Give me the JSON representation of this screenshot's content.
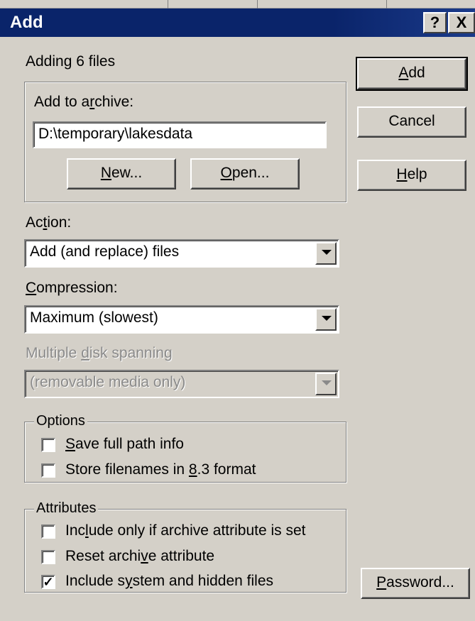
{
  "window": {
    "title": "Add",
    "help_button": "?",
    "close_button": "X"
  },
  "status": "Adding 6 files",
  "archive_group": {
    "label_pre": "Add to a",
    "label_ul": "r",
    "label_post": "chive:",
    "path_value": "D:\\temporary\\lakesdata",
    "new_pre": "",
    "new_ul": "N",
    "new_post": "ew...",
    "open_pre": "",
    "open_ul": "O",
    "open_post": "pen..."
  },
  "buttons": {
    "add_ul": "A",
    "add_post": "dd",
    "cancel": "Cancel",
    "help_ul": "H",
    "help_post": "elp",
    "password_ul": "P",
    "password_post": "assword..."
  },
  "action": {
    "label_pre": "Ac",
    "label_ul": "t",
    "label_post": "ion:",
    "selected": "Add (and replace) files"
  },
  "compression": {
    "label_pre": "",
    "label_ul": "C",
    "label_post": "ompression:",
    "selected": "Maximum (slowest)"
  },
  "spanning": {
    "label_pre": "Multiple ",
    "label_ul": "d",
    "label_post": "isk spanning",
    "selected": "(removable media only)"
  },
  "options": {
    "legend": "Options",
    "items": [
      {
        "pre": "",
        "ul": "S",
        "post": "ave full path info",
        "checked": ""
      },
      {
        "pre": "Store filenames in ",
        "ul": "8",
        "post": ".3 format",
        "checked": ""
      }
    ]
  },
  "attributes": {
    "legend": "Attributes",
    "items": [
      {
        "pre": "Inc",
        "ul": "l",
        "post": "ude only if archive attribute is set",
        "checked": ""
      },
      {
        "pre": "Reset archi",
        "ul": "v",
        "post": "e attribute",
        "checked": ""
      },
      {
        "pre": "Include s",
        "ul": "y",
        "post": "stem and hidden files",
        "checked": "✓"
      }
    ]
  }
}
